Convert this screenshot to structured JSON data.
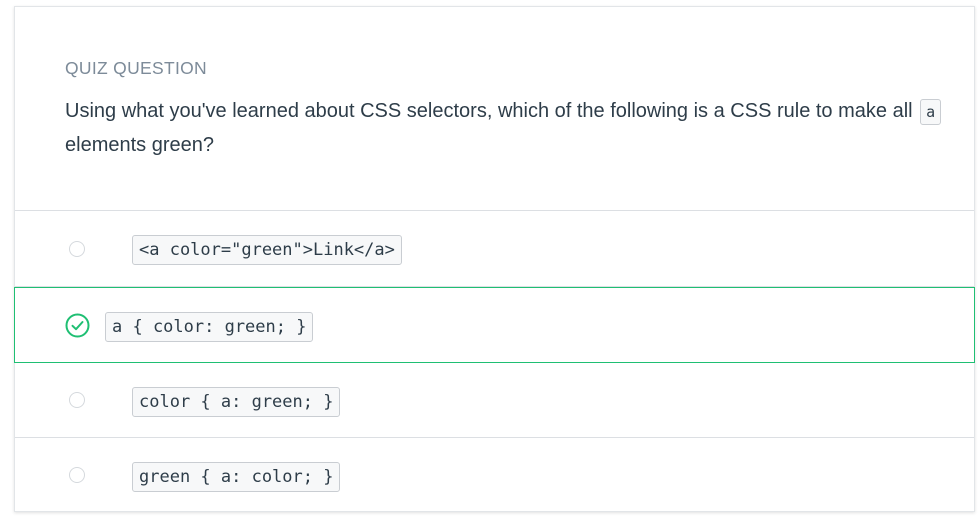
{
  "quiz": {
    "eyebrow": "QUIZ QUESTION",
    "question_before": "Using what you've learned about CSS selectors, which of the following is a CSS rule to make all",
    "question_code": "a",
    "question_after": "elements green?"
  },
  "options": [
    {
      "code": "<a color=\"green\">Link</a>",
      "selected": false
    },
    {
      "code": "a { color: green; }",
      "selected": true
    },
    {
      "code": "color { a: green; }",
      "selected": false
    },
    {
      "code": "green { a: color; }",
      "selected": false
    }
  ],
  "colors": {
    "correct": "#1fbf73",
    "text": "#2e3d49",
    "muted": "#7d8b99"
  },
  "icons": {
    "selected_state": "check-circle-icon",
    "unselected_state": "radio-circle-icon"
  }
}
